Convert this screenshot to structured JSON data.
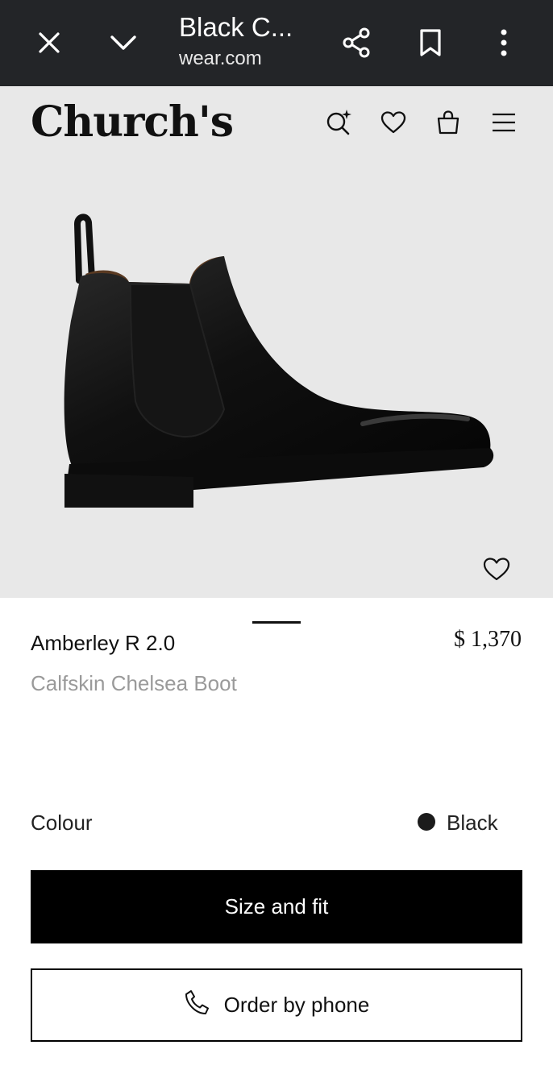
{
  "browser": {
    "title": "Black C...",
    "url": "wear.com",
    "icons": [
      "close-icon",
      "chevron-down-icon",
      "share-icon",
      "bookmark-icon",
      "more-vert-icon"
    ]
  },
  "header": {
    "logo": "Church's",
    "icons": [
      "search-sparkle-icon",
      "heart-icon",
      "shopping-bag-icon",
      "menu-icon"
    ]
  },
  "product": {
    "name": "Amberley R 2.0",
    "subtitle": "Calfskin Chelsea Boot",
    "price": "$ 1,370",
    "image_alt": "black chelsea boot"
  },
  "colour": {
    "label": "Colour",
    "value": "Black",
    "swatch": "#1b1b1b"
  },
  "actions": {
    "primary_label": "Size and fit",
    "secondary_label": "Order by phone"
  }
}
